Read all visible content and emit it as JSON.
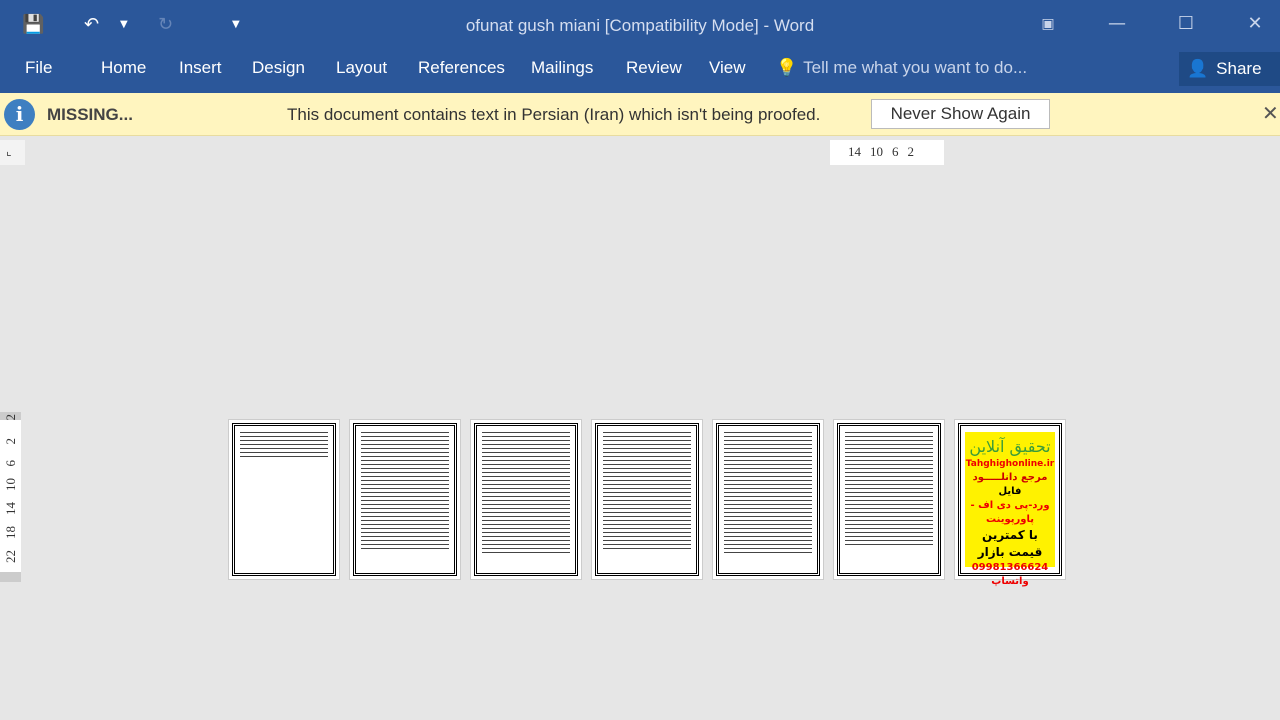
{
  "window": {
    "title": "ofunat gush miani [Compatibility Mode] - Word"
  },
  "qat": {
    "save_icon": "save-icon",
    "undo_icon": "undo-icon",
    "redo_icon": "redo-icon",
    "customize_icon": "dropdown-icon"
  },
  "ribbon": {
    "tabs": [
      "File",
      "Home",
      "Insert",
      "Design",
      "Layout",
      "References",
      "Mailings",
      "Review",
      "View"
    ],
    "tell_me": "Tell me what you want to do...",
    "share": "Share"
  },
  "message_bar": {
    "label": "MISSING...",
    "text": "This document contains text in Persian (Iran) which isn't being proofed.",
    "button": "Never Show Again"
  },
  "ruler": {
    "horizontal": [
      "14",
      "10",
      "6",
      "2"
    ],
    "vertical": [
      "2",
      "2",
      "6",
      "10",
      "14",
      "18",
      "22"
    ]
  },
  "ad_page": {
    "title": "تحقیق آنلاین",
    "site": "Tahghighonline.ir",
    "line1": "مرجع دانلـــــود",
    "line2": "فایل",
    "line3": "ورد-پی دی اف - پاورپوینت",
    "line4": "با کمترین قیمت بازار",
    "line5": "09981366624 واتساپ"
  },
  "colors": {
    "accent": "#2b579a",
    "message_bar": "#fff5bf",
    "ad_bg": "#fff200"
  }
}
